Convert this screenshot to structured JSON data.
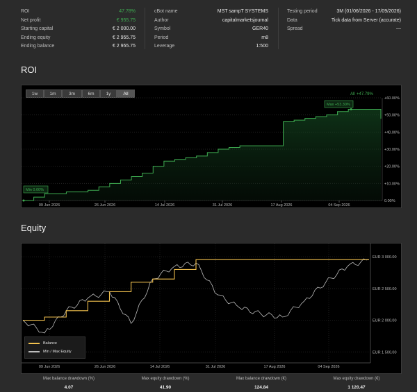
{
  "stats": {
    "col1": [
      {
        "label": "ROI",
        "value": "47.78%",
        "highlight": true
      },
      {
        "label": "Net profit",
        "value": "€ 955.75",
        "highlight": true
      },
      {
        "label": "Starting capital",
        "value": "€ 2 000.00",
        "highlight": false
      },
      {
        "label": "Ending equity",
        "value": "€ 2 955.75",
        "highlight": false
      },
      {
        "label": "Ending balance",
        "value": "€ 2 955.75",
        "highlight": false
      }
    ],
    "col2": [
      {
        "label": "cBot name",
        "value": "MST sampT SYSTEMS"
      },
      {
        "label": "Author",
        "value": "capitalmarketsjournal"
      },
      {
        "label": "Symbol",
        "value": "GER40"
      },
      {
        "label": "Period",
        "value": "m8"
      },
      {
        "label": "Leverage",
        "value": "1:500"
      }
    ],
    "col3": [
      {
        "label": "Testing period",
        "value": "3M (01/06/2026 - 17/09/2026)"
      },
      {
        "label": "Data",
        "value": "Tick data from Server (accurate)"
      },
      {
        "label": "Spread",
        "value": "—"
      }
    ]
  },
  "roi_section": {
    "title": "ROI",
    "periods": [
      "1w",
      "1m",
      "3m",
      "6m",
      "1y",
      "All"
    ],
    "active_period": "All",
    "current_label": "All",
    "current_value": "+47.79%",
    "max_label": "Max +53.30%",
    "min_label": "Min 0.00%",
    "x_ticks": [
      "09 Jun 2026",
      "26 Jun 2026",
      "14 Jul 2026",
      "31 Jul 2026",
      "17 Aug 2026",
      "04 Sep 2026"
    ],
    "y_ticks": [
      "+60.00%",
      "+50.00%",
      "+40.00%",
      "+30.00%",
      "+20.00%",
      "+10.00%",
      "0.00%"
    ]
  },
  "equity_section": {
    "title": "Equity",
    "x_ticks": [
      "09 Jun 2026",
      "26 Jun 2026",
      "14 Jul 2026",
      "31 Jul 2026",
      "17 Aug 2026",
      "04 Sep 2026"
    ],
    "y_ticks": [
      "EUR 3 000.00",
      "EUR 2 500.00",
      "EUR 2 000.00",
      "EUR 1 500.00"
    ],
    "legend_balance": "Balance",
    "legend_equity": "Min / Max Equity"
  },
  "summary": [
    {
      "label": "Max balance drawdown (%)",
      "value": "4.07"
    },
    {
      "label": "Max equity drawdown (%)",
      "value": "41.90"
    },
    {
      "label": "Max balance drawdown (€)",
      "value": "124.84"
    },
    {
      "label": "Max equity drawdown (€)",
      "value": "1 120.47"
    }
  ],
  "colors": {
    "green": "#3fae52",
    "balance": "#f2c14e",
    "equity": "#bdbdbd",
    "panel": "#000000",
    "background": "#2b2b2b"
  },
  "chart_data": [
    {
      "type": "area",
      "title": "ROI",
      "x": [
        "01 Jun 2026",
        "03 Jun 2026",
        "05 Jun 2026",
        "07 Jun 2026",
        "09 Jun 2026",
        "11 Jun 2026",
        "13 Jun 2026",
        "15 Jun 2026",
        "17 Jun 2026",
        "19 Jun 2026",
        "21 Jun 2026",
        "23 Jun 2026",
        "25 Jun 2026",
        "27 Jun 2026",
        "29 Jun 2026",
        "01 Jul 2026",
        "03 Jul 2026",
        "05 Jul 2026",
        "07 Jul 2026",
        "09 Jul 2026",
        "11 Jul 2026",
        "13 Jul 2026",
        "15 Jul 2026",
        "17 Jul 2026",
        "19 Jul 2026",
        "21 Jul 2026",
        "23 Jul 2026",
        "25 Jul 2026",
        "27 Jul 2026",
        "29 Jul 2026",
        "31 Jul 2026",
        "17 Aug 2026",
        "04 Sep 2026",
        "17 Sep 2026"
      ],
      "series": [
        {
          "values": [
            0,
            2,
            4,
            4,
            5,
            5,
            6,
            8,
            10,
            12,
            14,
            16,
            20,
            23,
            24,
            25,
            26,
            28,
            30,
            31,
            32,
            32,
            32,
            32,
            46,
            47,
            48,
            49,
            50,
            52,
            53.3,
            53.3,
            53.3,
            47.79
          ]
        }
      ],
      "ylim": [
        0,
        60
      ]
    },
    {
      "type": "line",
      "title": "Equity",
      "x": [
        "01 Jun 2026",
        "08 Jun 2026",
        "15 Jun 2026",
        "22 Jun 2026",
        "29 Jun 2026",
        "06 Jul 2026",
        "13 Jul 2026",
        "20 Jul 2026",
        "27 Jul 2026",
        "03 Aug 2026",
        "10 Aug 2026",
        "17 Aug 2026",
        "24 Aug 2026",
        "31 Aug 2026",
        "07 Sep 2026",
        "14 Sep 2026",
        "17 Sep 2026"
      ],
      "series": [
        {
          "name": "Balance",
          "values": [
            2000,
            2050,
            2150,
            2300,
            2450,
            2600,
            2650,
            2800,
            2955.75,
            2955.75,
            2955.75,
            2955.75,
            2955.75,
            2955.75,
            2955.75,
            2955.75,
            2955.75
          ]
        },
        {
          "name": "Min / Max Equity",
          "values": [
            2000,
            1800,
            2150,
            2350,
            2450,
            1950,
            2650,
            2850,
            2900,
            2400,
            2200,
            2100,
            2050,
            2300,
            2600,
            2850,
            2955.75
          ]
        }
      ],
      "ylim": [
        1350,
        3100
      ]
    }
  ]
}
